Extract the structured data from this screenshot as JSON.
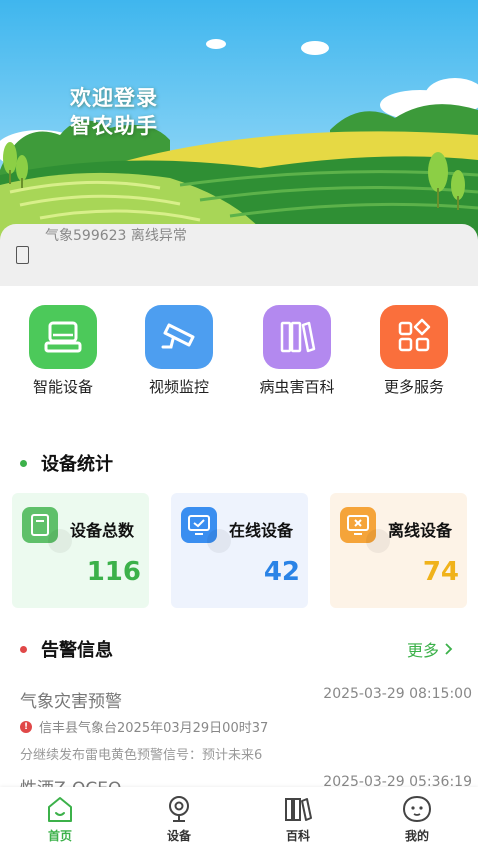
{
  "hero": {
    "title_line1": "欢迎登录",
    "title_line2": "智农助手"
  },
  "station": {
    "status_text": "气象599623 离线异常"
  },
  "menu": {
    "items": [
      {
        "label": "智能设备",
        "icon": "device-icon",
        "color": "#4cc95a"
      },
      {
        "label": "视频监控",
        "icon": "camera-icon",
        "color": "#4d9ef0"
      },
      {
        "label": "病虫害百科",
        "icon": "books-icon",
        "color": "#b389ef"
      },
      {
        "label": "更多服务",
        "icon": "grid-icon",
        "color": "#fa6f3c"
      }
    ]
  },
  "device_stats": {
    "title": "设备统计",
    "cards": [
      {
        "label": "设备总数",
        "value": "116",
        "value_color": "#3cb14a",
        "bg": "#ecfaef"
      },
      {
        "label": "在线设备",
        "value": "42",
        "value_color": "#2a83e6",
        "bg": "#eef3fd"
      },
      {
        "label": "离线设备",
        "value": "74",
        "value_color": "#f0b21a",
        "bg": "#fdf3e7"
      }
    ]
  },
  "alerts": {
    "title": "告警信息",
    "more_label": "更多",
    "items": [
      {
        "title": "气象灾害预警",
        "time": "2025-03-29 08:15:00",
        "source": "信丰县气象台2025年03月29日00时37",
        "desc": "分继续发布雷电黄色预警信号：预计未来6"
      },
      {
        "title": "性酒Z-OCEO",
        "time": "2025-03-29 05:36:19"
      }
    ]
  },
  "tabbar": {
    "items": [
      {
        "label": "首页",
        "active": true
      },
      {
        "label": "设备",
        "active": false
      },
      {
        "label": "百科",
        "active": false
      },
      {
        "label": "我的",
        "active": false
      }
    ]
  },
  "colors": {
    "accent": "#3cb14a",
    "alert_dot": "#e04848"
  }
}
